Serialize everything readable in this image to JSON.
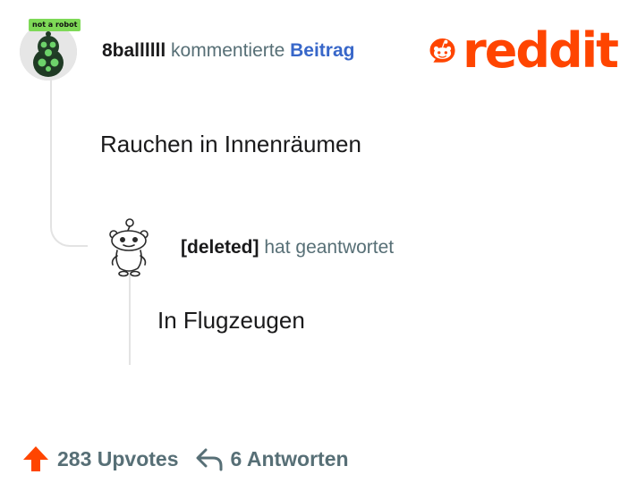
{
  "comment": {
    "author": "8ballllll",
    "action": "kommentierte",
    "target": "Beitrag",
    "badge": "not a robot",
    "text": "Rauchen in Innenräumen"
  },
  "reply": {
    "author": "[deleted]",
    "action": "hat geantwortet",
    "text": "In Flugzeugen"
  },
  "brand": {
    "name": "reddit",
    "color": "#ff4500"
  },
  "footer": {
    "upvotes": "283 Upvotes",
    "replies": "6 Antworten"
  },
  "icons": {
    "upvote": "upvote-arrow-icon",
    "reply": "reply-arrow-icon",
    "logo": "reddit-snoo-logo-icon"
  },
  "colors": {
    "link": "#3867c9",
    "muted": "#576f76",
    "accent": "#ff4500",
    "thread_line": "#e3e3e3"
  }
}
